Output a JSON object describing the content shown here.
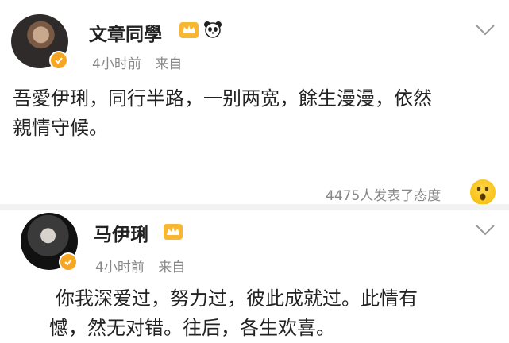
{
  "post1": {
    "name": "文章同學",
    "time": "4小时前",
    "source": "来自",
    "content_line1": "吾愛伊琍，同行半路，一别两宽，餘生漫漫，依然",
    "content_line2": "親情守候。",
    "reactions_text": "4475人发表了态度"
  },
  "post2": {
    "name": "马伊琍",
    "time": "4小时前",
    "source": "来自",
    "content_line1": "你我深爱过，努力过，彼此成就过。此情有",
    "content_line2": "憾，然无对错。往后，各生欢喜。"
  },
  "colors": {
    "verified_badge": "#f5a623",
    "meta_gray": "#888888",
    "text": "#222222"
  }
}
